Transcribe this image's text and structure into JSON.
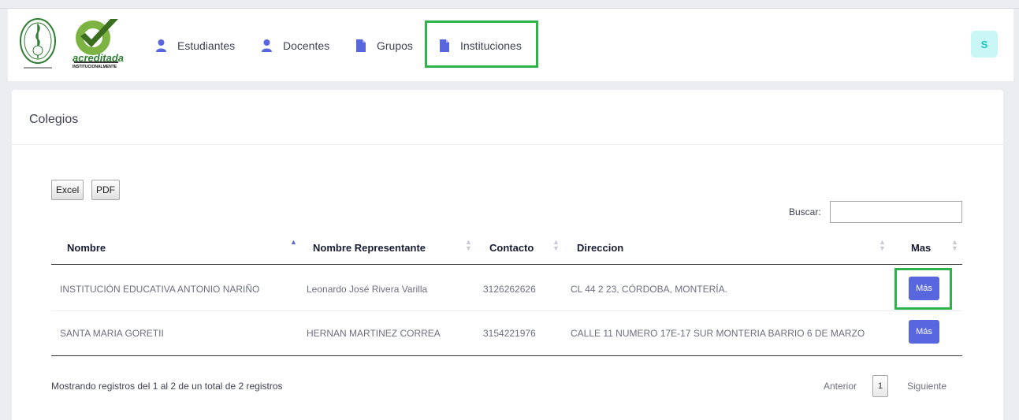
{
  "nav": {
    "items": [
      {
        "label": "Estudiantes",
        "icon": "user-icon"
      },
      {
        "label": "Docentes",
        "icon": "user-icon"
      },
      {
        "label": "Grupos",
        "icon": "document-icon"
      },
      {
        "label": "Instituciones",
        "icon": "document-icon"
      }
    ],
    "avatar": "S",
    "logo_text": "acreditada",
    "logo_subtext": "INSTITUCIONALMENTE"
  },
  "card": {
    "title": "Colegios"
  },
  "export": {
    "excel": "Excel",
    "pdf": "PDF"
  },
  "search": {
    "label": "Buscar:",
    "value": ""
  },
  "table": {
    "headers": [
      "Nombre",
      "Nombre Representante",
      "Contacto",
      "Direccion",
      "Mas"
    ],
    "rows": [
      {
        "nombre": "INSTITUCIÓN EDUCATIVA ANTONIO NARIÑO",
        "representante": "Leonardo José Rivera Varilla",
        "contacto": "3126262626",
        "direccion": "CL 44 2 23, CÓRDOBA, MONTERÍA.",
        "action": "Más"
      },
      {
        "nombre": "SANTA MARIA GORETII",
        "representante": "HERNAN MARTINEZ CORREA",
        "contacto": "3154221976",
        "direccion": "CALLE 11 NUMERO 17E-17 SUR MONTERIA BARRIO 6 DE MARZO",
        "action": "Más"
      }
    ]
  },
  "footer": {
    "info": "Mostrando registros del 1 al 2 de un total de 2 registros",
    "prev": "Anterior",
    "page": "1",
    "next": "Siguiente"
  },
  "colors": {
    "accent": "#5867dd",
    "highlight": "#2db34a",
    "avatar_bg": "#c9f7f5",
    "avatar_fg": "#1bc5bd"
  }
}
